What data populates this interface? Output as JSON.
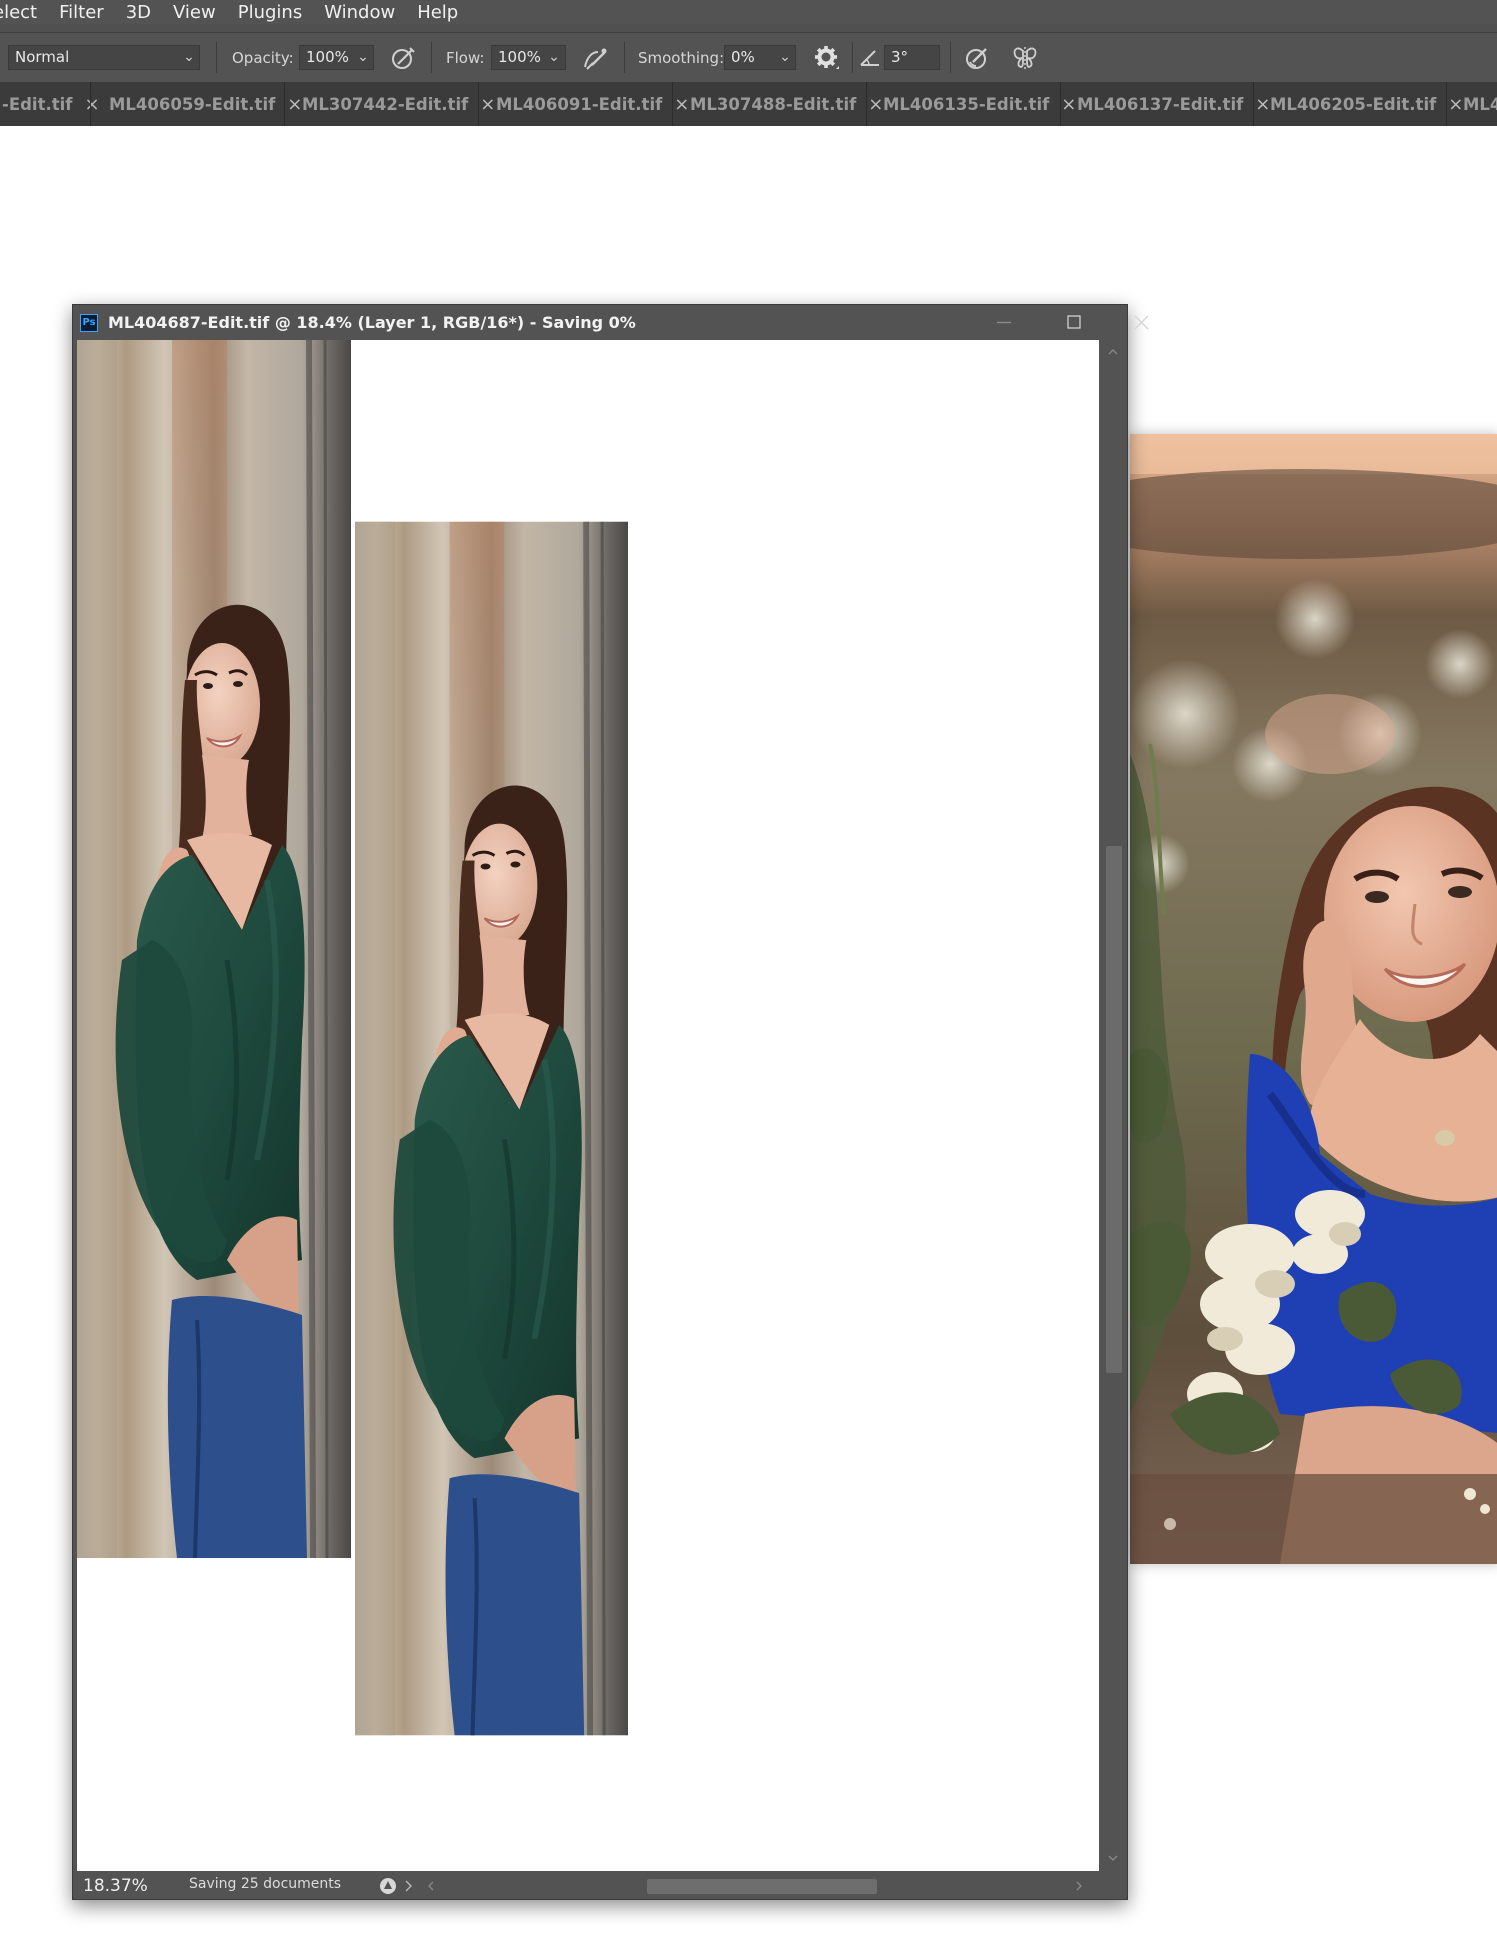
{
  "menu": [
    "elect",
    "Filter",
    "3D",
    "View",
    "Plugins",
    "Window",
    "Help"
  ],
  "options": {
    "blend_mode": "Normal",
    "opacity_label": "Opacity:",
    "opacity_value": "100%",
    "flow_label": "Flow:",
    "flow_value": "100%",
    "smoothing_label": "Smoothing:",
    "smoothing_value": "0%",
    "angle_value": "3°"
  },
  "tabs": [
    "-Edit.tif",
    "ML406059-Edit.tif",
    "ML307442-Edit.tif",
    "ML406091-Edit.tif",
    "ML307488-Edit.tif",
    "ML406135-Edit.tif",
    "ML406137-Edit.tif",
    "ML406205-Edit.tif",
    "ML4"
  ],
  "tab_close_glyph": "×",
  "document": {
    "title": "ML404687-Edit.tif @ 18.4% (Layer 1, RGB/16*) - Saving 0%",
    "app_badge": "Ps",
    "zoom": "18.37%",
    "status_text": "Saving 25 documents"
  },
  "colors": {
    "app_chrome": "#535353",
    "tab_bar": "#3b3b3b",
    "canvas": "#ffffff",
    "ps_blue": "#31a8ff",
    "blouse_green": "#1f4a3e",
    "dress_blue": "#1f3fb5"
  },
  "icons": [
    "airbrush-icon",
    "flow-pressure-icon",
    "gear-icon",
    "angle-icon",
    "pressure-size-icon",
    "symmetry-icon",
    "minimize-icon",
    "maximize-icon",
    "close-icon",
    "ps-logo-icon",
    "export-status-icon"
  ]
}
